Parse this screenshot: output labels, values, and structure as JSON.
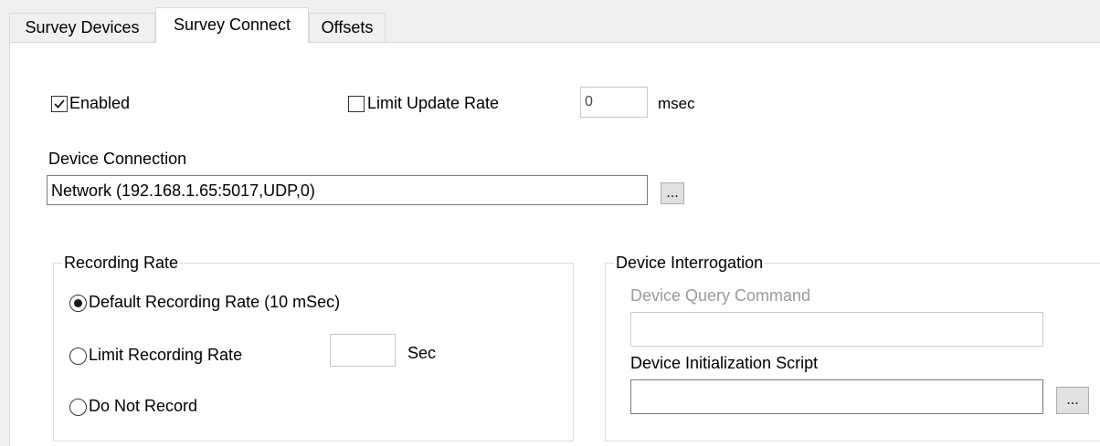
{
  "tabs": [
    {
      "label": "Survey Devices",
      "active": false
    },
    {
      "label": "Survey Connect",
      "active": true
    },
    {
      "label": "Offsets",
      "active": false
    }
  ],
  "enabled": {
    "label": "Enabled",
    "checked": true
  },
  "limit_update_rate": {
    "label": "Limit Update Rate",
    "checked": false,
    "value": "0",
    "unit": "msec"
  },
  "device_connection": {
    "label": "Device Connection",
    "value": "Network (192.168.1.65:5017,UDP,0)",
    "browse_label": "..."
  },
  "recording_rate": {
    "title": "Recording Rate",
    "options": [
      {
        "label": "Default Recording Rate (10 mSec)",
        "selected": true
      },
      {
        "label": "Limit Recording Rate",
        "selected": false
      },
      {
        "label": "Do Not Record",
        "selected": false
      }
    ],
    "limit_value": "",
    "limit_unit": "Sec"
  },
  "device_interrogation": {
    "title": "Device Interrogation",
    "query_label": "Device Query Command",
    "query_value": "",
    "init_label": "Device Initialization Script",
    "init_value": "",
    "init_browse_label": "..."
  }
}
